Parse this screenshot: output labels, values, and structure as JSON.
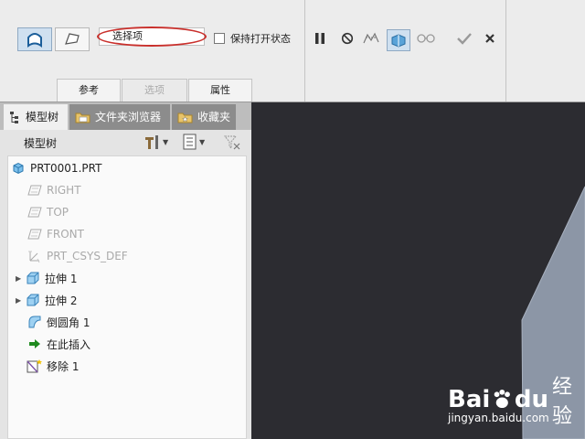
{
  "toolbar": {
    "collector_text": "选择项",
    "keep_open_label": "保持打开状态"
  },
  "dashboard_tabs": [
    {
      "label": "参考",
      "state": "active"
    },
    {
      "label": "选项",
      "state": "disabled"
    },
    {
      "label": "属性",
      "state": "active"
    }
  ],
  "panel_tabs": [
    {
      "label": "模型树",
      "icon": "model-tree-icon"
    },
    {
      "label": "文件夹浏览器",
      "icon": "folder-icon"
    },
    {
      "label": "收藏夹",
      "icon": "favorites-icon"
    }
  ],
  "model_tree": {
    "title": "模型树",
    "items": [
      {
        "label": "PRT0001.PRT",
        "icon": "part-icon",
        "muted": false,
        "expandable": false
      },
      {
        "label": "RIGHT",
        "icon": "datum-plane-icon",
        "muted": true,
        "expandable": false
      },
      {
        "label": "TOP",
        "icon": "datum-plane-icon",
        "muted": true,
        "expandable": false
      },
      {
        "label": "FRONT",
        "icon": "datum-plane-icon",
        "muted": true,
        "expandable": false
      },
      {
        "label": "PRT_CSYS_DEF",
        "icon": "csys-icon",
        "muted": true,
        "expandable": false
      },
      {
        "label": "拉伸 1",
        "icon": "extrude-icon",
        "muted": false,
        "expandable": true
      },
      {
        "label": "拉伸 2",
        "icon": "extrude-icon",
        "muted": false,
        "expandable": true
      },
      {
        "label": "倒圆角 1",
        "icon": "round-icon",
        "muted": false,
        "expandable": false
      },
      {
        "label": "在此插入",
        "icon": "insert-arrow-icon",
        "muted": false,
        "expandable": false
      },
      {
        "label": "移除 1",
        "icon": "remove-feature-icon",
        "muted": false,
        "expandable": false
      }
    ]
  },
  "watermark": {
    "brand_a": "Bai",
    "brand_b": "du",
    "brand_c": "经验",
    "url": "jingyan.baidu.com"
  },
  "colors": {
    "viewport_bg": "#2c2c31",
    "solid_face": "#8c96a6",
    "highlight_ellipse": "#c9302c"
  }
}
